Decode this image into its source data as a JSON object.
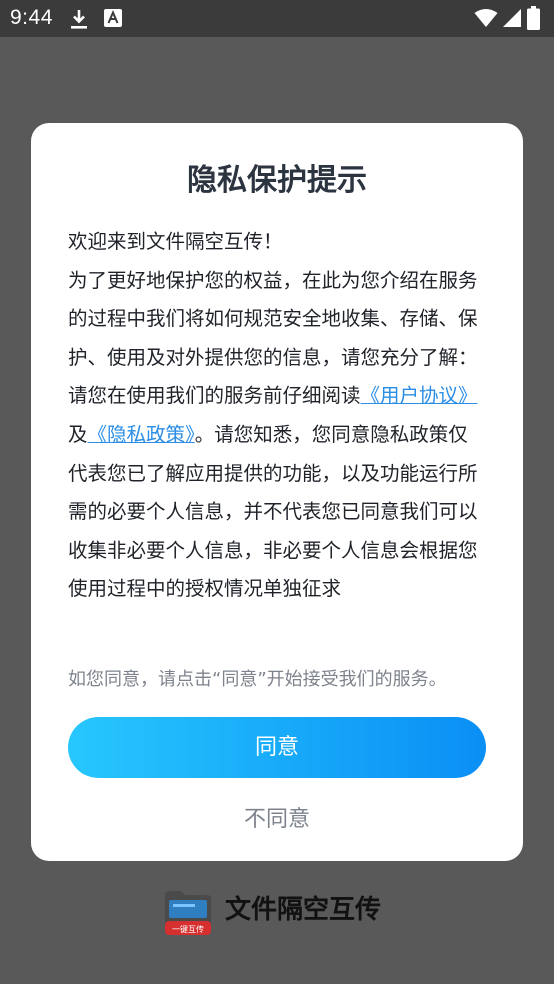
{
  "status_bar": {
    "time": "9:44",
    "icons": [
      "download-icon",
      "text-a-icon",
      "wifi-icon",
      "signal-icon",
      "battery-icon"
    ]
  },
  "dialog": {
    "title": "隐私保护提示",
    "welcome": "欢迎来到文件隔空互传！",
    "paragraph1": "为了更好地保护您的权益，在此为您介绍在服务的过程中我们将如何规范安全地收集、存储、保护、使用及对外提供您的信息，请您充分了解：",
    "paragraph2_prefix": "请您在使用我们的服务前仔细阅读",
    "user_agreement_link": "《用户协议》",
    "and": "及",
    "privacy_policy_link": "《隐私政策》",
    "paragraph2_suffix": "。请您知悉，您同意隐私政策仅代表您已了解应用提供的功能，以及功能运行所需的必要个人信息，并不代表您已同意我们可以收集非必要个人信息，非必要个人信息会根据您使用过程中的授权情况单独征求",
    "note": "如您同意，请点击“同意”开始接受我们的服务。",
    "agree_label": "同意",
    "disagree_label": "不同意"
  },
  "brand": {
    "logo_text": "一键互传",
    "name": "文件隔空互传"
  },
  "colors": {
    "link": "#2a8de6",
    "button_gradient_start": "#27c7fe",
    "button_gradient_end": "#0a8ff5",
    "overlay": "#595959"
  }
}
